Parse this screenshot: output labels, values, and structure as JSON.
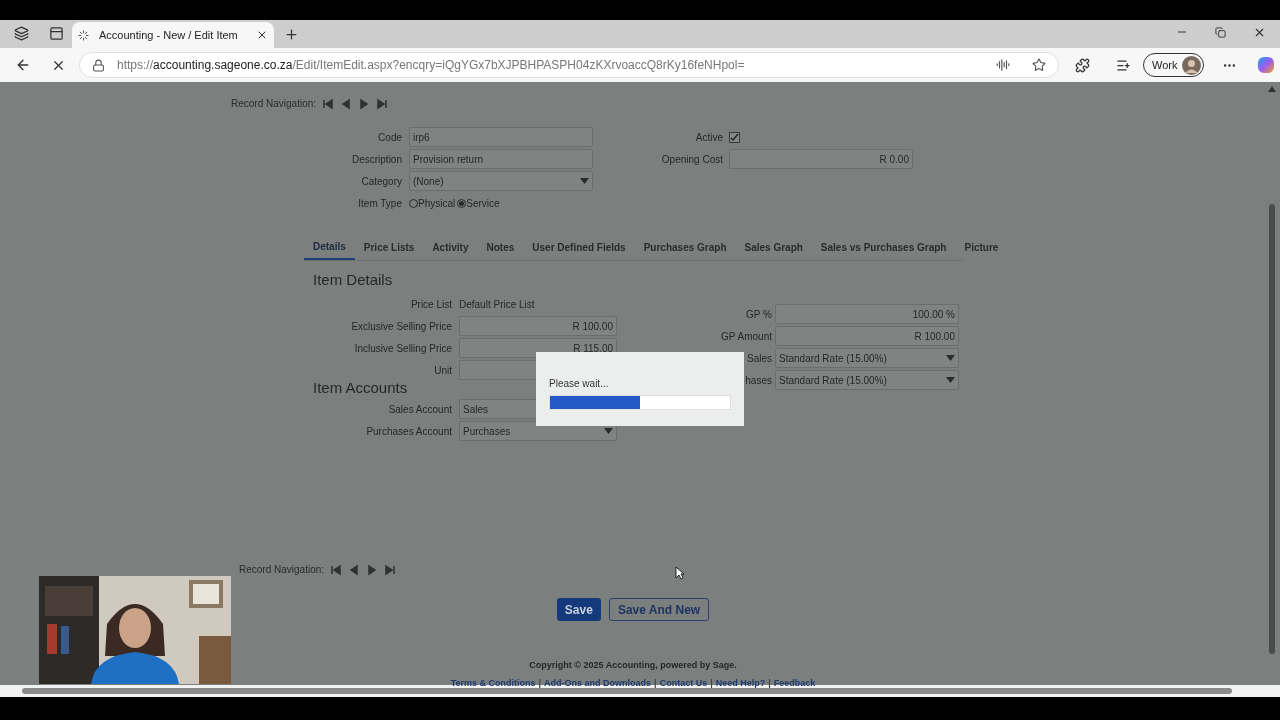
{
  "browser": {
    "tabs": [
      {
        "title": "Accounting - New / Edit Item",
        "selected": true
      }
    ],
    "url": {
      "scheme": "https://",
      "host": "accounting.sageone.co.za",
      "path": "/Edit/ItemEdit.aspx?encqry=iQgYGx7bXJPBHPASPH04zKXrvoaccQ8rKy16feNHpol="
    },
    "profile": "Work"
  },
  "record_navigation_top": {
    "label": "Record Navigation:"
  },
  "header_fields": {
    "left": [
      {
        "label": "Code",
        "kind": "text",
        "value": "irp6"
      },
      {
        "label": "Description",
        "kind": "text",
        "value": "Provision return"
      },
      {
        "label": "Category",
        "kind": "select",
        "value": "(None)"
      },
      {
        "label": "Item Type",
        "kind": "radio",
        "options": [
          {
            "label": "Physical",
            "selected": false
          },
          {
            "label": "Service",
            "selected": true
          }
        ]
      }
    ],
    "right": [
      {
        "label": "Active",
        "kind": "checkbox",
        "checked": true
      },
      {
        "label": "Opening Cost",
        "kind": "amount",
        "value": "R 0.00"
      }
    ]
  },
  "tabs": [
    {
      "label": "Details",
      "selected": true
    },
    {
      "label": "Price Lists",
      "selected": false
    },
    {
      "label": "Activity",
      "selected": false
    },
    {
      "label": "Notes",
      "selected": false
    },
    {
      "label": "User Defined Fields",
      "selected": false
    },
    {
      "label": "Purchases Graph",
      "selected": false
    },
    {
      "label": "Sales Graph",
      "selected": false
    },
    {
      "label": "Sales vs Purchases Graph",
      "selected": false
    },
    {
      "label": "Picture",
      "selected": false
    }
  ],
  "item_details": {
    "title": "Item Details",
    "left_fields": [
      {
        "label": "Price List",
        "kind": "static",
        "value": "Default Price List"
      },
      {
        "label": "Exclusive Selling Price",
        "kind": "amount",
        "value": "R 100.00"
      },
      {
        "label": "Inclusive Selling Price",
        "kind": "amount",
        "value": "R 115.00"
      },
      {
        "label": "Unit",
        "kind": "text"
      }
    ],
    "right_fields": [
      {
        "label": "GP %",
        "kind": "amount",
        "value": "100.00 %"
      },
      {
        "label": "GP Amount",
        "kind": "amount",
        "value": "R 100.00"
      },
      {
        "label": "Sales",
        "kind": "select",
        "value": "Standard Rate (15.00%)"
      },
      {
        "label": "hases",
        "kind": "select",
        "value": "Standard Rate (15.00%)"
      }
    ]
  },
  "item_accounts": {
    "title": "Item Accounts",
    "fields": [
      {
        "label": "Sales Account",
        "kind": "select",
        "value": "Sales"
      },
      {
        "label": "Purchases Account",
        "kind": "select",
        "value": "Purchases"
      }
    ]
  },
  "record_navigation_bottom": {
    "label": "Record Navigation:"
  },
  "buttons": [
    {
      "label": "Save",
      "kind": "primary"
    },
    {
      "label": "Save And New",
      "kind": "secondary"
    }
  ],
  "footer": {
    "copyright": "Copyright © 2025 Accounting, powered by Sage.",
    "links": [
      "Terms & Conditions",
      "Add-Ons and Downloads",
      "Contact Us",
      "Need Help?",
      "Feedback"
    ],
    "separator": "|"
  },
  "dialog": {
    "message": "Please wait...",
    "level": 0.5
  }
}
